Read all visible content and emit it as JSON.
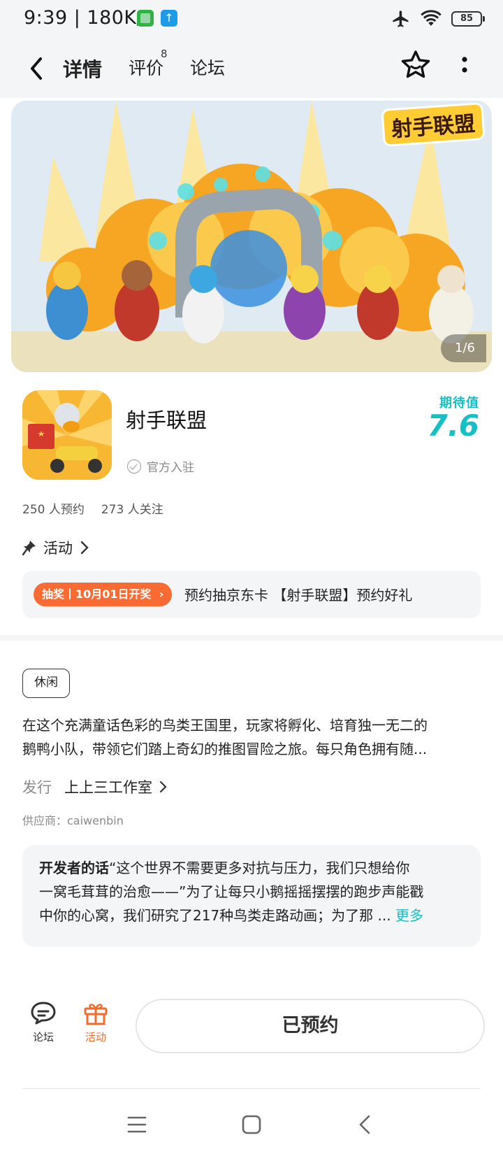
{
  "status_bar": {
    "time_speed": "9:39 | 180K/s",
    "battery": "85"
  },
  "nav": {
    "tabs": [
      {
        "label": "详情",
        "active": true
      },
      {
        "label": "评价",
        "count": "8"
      },
      {
        "label": "论坛"
      }
    ],
    "accent": "#14c9c9"
  },
  "banner": {
    "logo_text": "射手联盟",
    "counter": "1/6"
  },
  "app": {
    "name": "射手联盟",
    "official_label": "官方入驻",
    "expect_label": "期待值",
    "expect_score": "7.6",
    "reservations": "250 人预约",
    "followers": "273 人关注"
  },
  "activity": {
    "title": "活动",
    "tag": "抽奖丨10月01日开奖",
    "text": "预约抽京东卡 【射手联盟】预约好礼"
  },
  "details": {
    "genre": "休闲",
    "description_lines": [
      "在这个充满童话色彩的鸟类王国里，玩家将孵化、培育独一无二的",
      "鹅鸭小队，带领它们踏上奇幻的推图冒险之旅。每只角色拥有随..."
    ],
    "publisher_label": "发行",
    "publisher_name": "上上三工作室",
    "supplier": "供应商：caiwenbin"
  },
  "developer_note": {
    "title": "开发者的话",
    "line1": "“这个世界不需要更多对抗与压力，我们只想给你",
    "line2": "一窝毛茸茸的治愈——”为了让每只小鹅摇摇摆摆的跑步声能戳",
    "line3": "中你的心窝，我们研究了217种鸟类走路动画；为了那 ...",
    "more": "更多"
  },
  "action_bar": {
    "forum_label": "论坛",
    "activity_label": "活动",
    "reserve_label": "已预约",
    "activity_color": "#f26c2d"
  },
  "icons": [
    "back-icon",
    "star-icon",
    "more-icon",
    "pin-icon",
    "chevron-right-icon",
    "check-circle-icon",
    "forum-icon",
    "gift-icon",
    "menu-icon",
    "home-icon",
    "back-arrow-icon"
  ]
}
